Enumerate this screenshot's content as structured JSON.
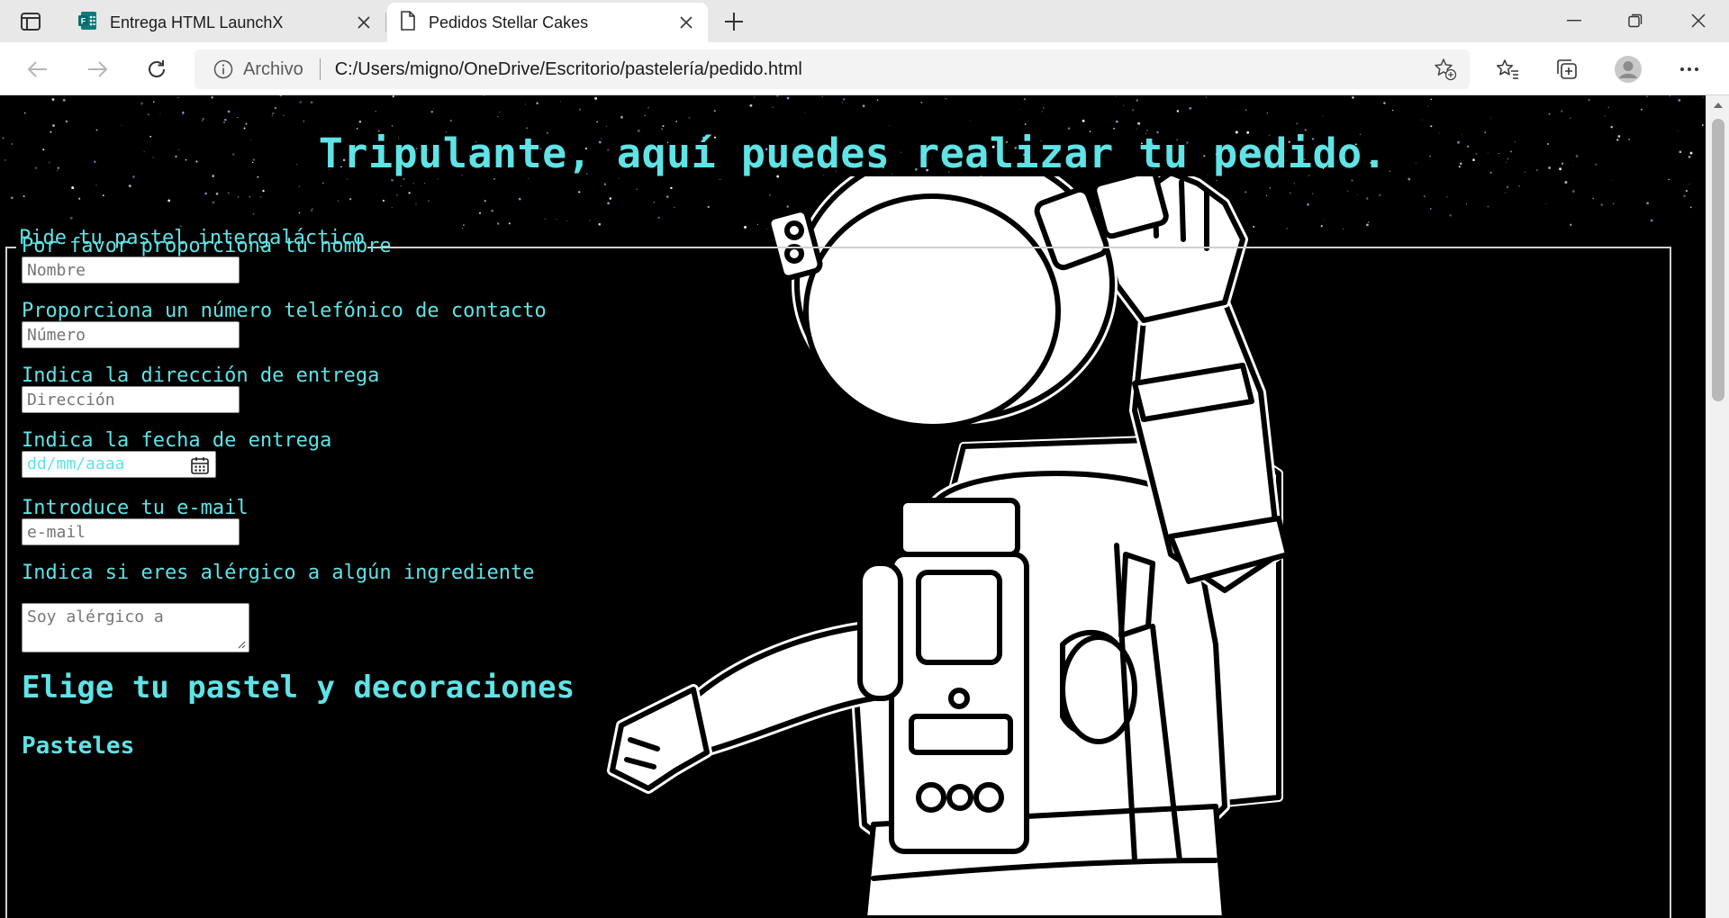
{
  "browser": {
    "tabs": [
      {
        "title": "Entrega HTML LaunchX",
        "active": false,
        "icon": "forms-app-icon"
      },
      {
        "title": "Pedidos Stellar Cakes",
        "active": true,
        "icon": "document-icon"
      }
    ],
    "address": {
      "scheme_label": "Archivo",
      "url": "C:/Users/migno/OneDrive/Escritorio/pastelería/pedido.html"
    }
  },
  "page": {
    "title": "Tripulante, aquí puedes realizar tu pedido.",
    "fieldset_legend": "Pide tu pastel intergaláctico",
    "fields": {
      "name": {
        "label": "Por favor proporciona tu nombre",
        "placeholder": "Nombre"
      },
      "phone": {
        "label": "Proporciona un número telefónico de contacto",
        "placeholder": "Número"
      },
      "address": {
        "label": "Indica la dirección de entrega",
        "placeholder": "Dirección"
      },
      "date": {
        "label": "Indica la fecha de entrega",
        "placeholder": "dd/mm/aaaa"
      },
      "email": {
        "label": "Introduce tu e-mail",
        "placeholder": "e-mail"
      },
      "allergy": {
        "label": "Indica si eres alérgico a algún ingrediente",
        "placeholder": "Soy alérgico a"
      }
    },
    "section_heading": "Elige tu pastel y decoraciones",
    "subsection_heading": "Pasteles"
  },
  "colors": {
    "accent": "#5fe3e6",
    "background": "#000000"
  }
}
